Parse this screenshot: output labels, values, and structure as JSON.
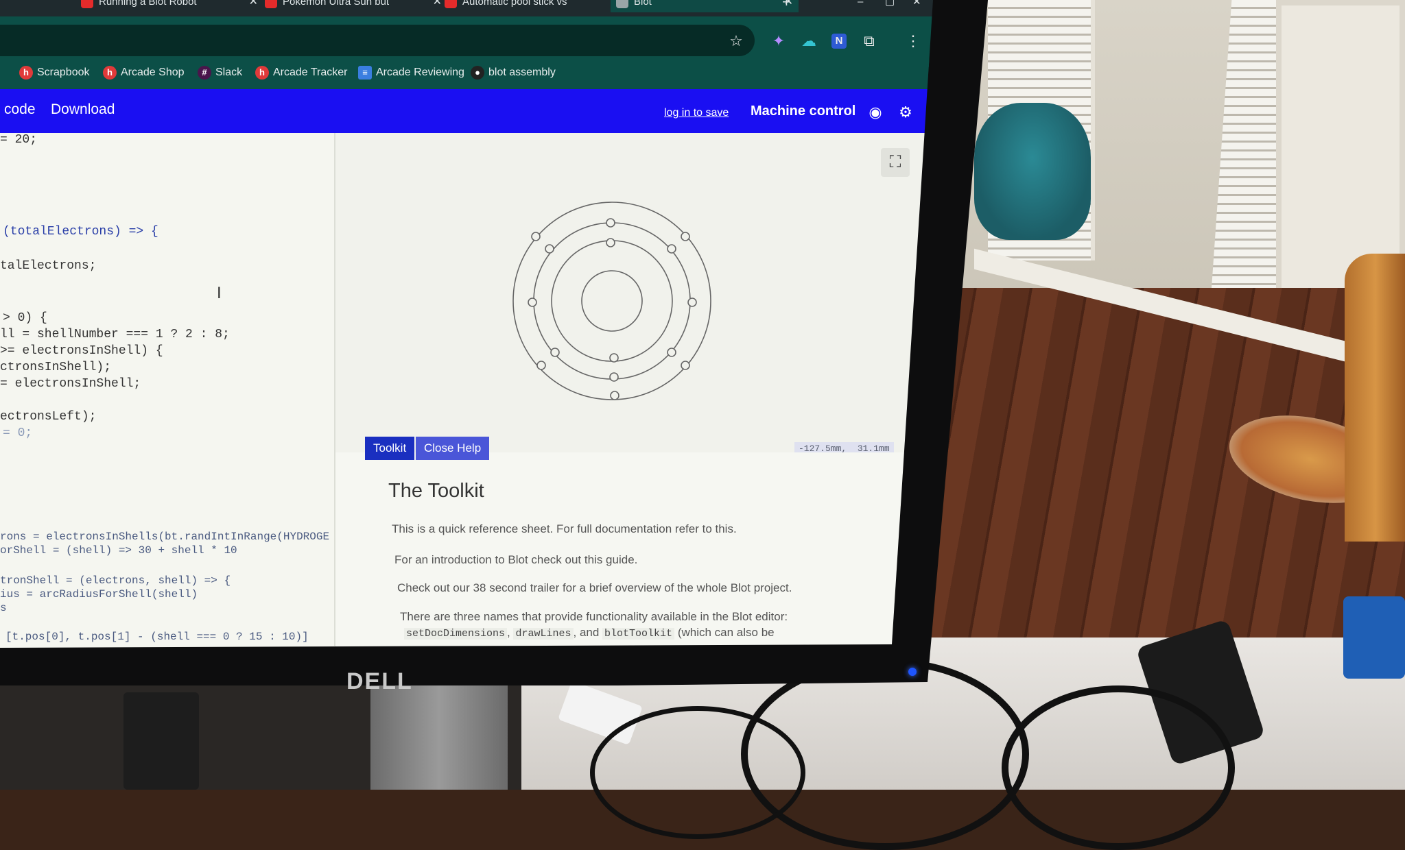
{
  "browser": {
    "tabs": [
      {
        "label": "Running a Blot Robot"
      },
      {
        "label": "Pokémon Ultra Sun but"
      },
      {
        "label": "Automatic pool stick vs"
      },
      {
        "label": "Blot"
      }
    ],
    "bookmarks": [
      {
        "label": "Scrapbook",
        "icon": "h-logo-icon"
      },
      {
        "label": "Arcade Shop",
        "icon": "h-logo-icon"
      },
      {
        "label": "Slack",
        "icon": "slack-icon"
      },
      {
        "label": "Arcade Tracker",
        "icon": "h-logo-icon"
      },
      {
        "label": "Arcade Reviewing",
        "icon": "doc-icon"
      },
      {
        "label": "blot assembly",
        "icon": "github-icon"
      }
    ],
    "extension_icons": [
      "star-icon",
      "puzzle-icon",
      "cloud-icon",
      "n-icon",
      "extensions-icon",
      "menu-icon"
    ]
  },
  "blot": {
    "nav": {
      "code": "code",
      "download": "Download"
    },
    "login": "log in to save",
    "machine_control": "Machine control",
    "coords": "-127.5mm,  31.1mm",
    "help": {
      "toolkit_tab": "Toolkit",
      "close_tab": "Close Help",
      "title": "The Toolkit",
      "p1": "This is a quick reference sheet. For full documentation refer to this.",
      "p2": "For an introduction to Blot check out this guide.",
      "p3": "Check out our 38 second trailer for a brief overview of the whole Blot project.",
      "p4": "There are three names that provide functionality available in the Blot editor:",
      "p5_code1": "setDocDimensions",
      "p5_code2": "drawLines",
      "p5_and": ", and",
      "p5_code3": "blotToolkit",
      "p5_tail": "(which can also be"
    }
  },
  "code_lines": [
    "= 20;",
    "(totalElectrons) => {",
    "talElectrons;",
    "> 0) {",
    "ll = shellNumber === 1 ? 2 : 8;",
    ">= electronsInShell) {",
    "ctronsInShell);",
    "= electronsInShell;",
    "ectronsLeft);",
    "= 0;",
    "rons = electronsInShells(bt.randIntInRange(HYDROGE",
    "orShell = (shell) => 30 + shell * 10",
    "tronShell = (electrons, shell) => {",
    "ius = arcRadiusForShell(shell)",
    "s",
    "[t.pos[0], t.pos[1] - (shell === 0 ? 15 : 10)]"
  ],
  "monitor_brand": "DELL",
  "colors": {
    "blot_header": "#1a0ff2",
    "chrome": "#0c4f47"
  }
}
